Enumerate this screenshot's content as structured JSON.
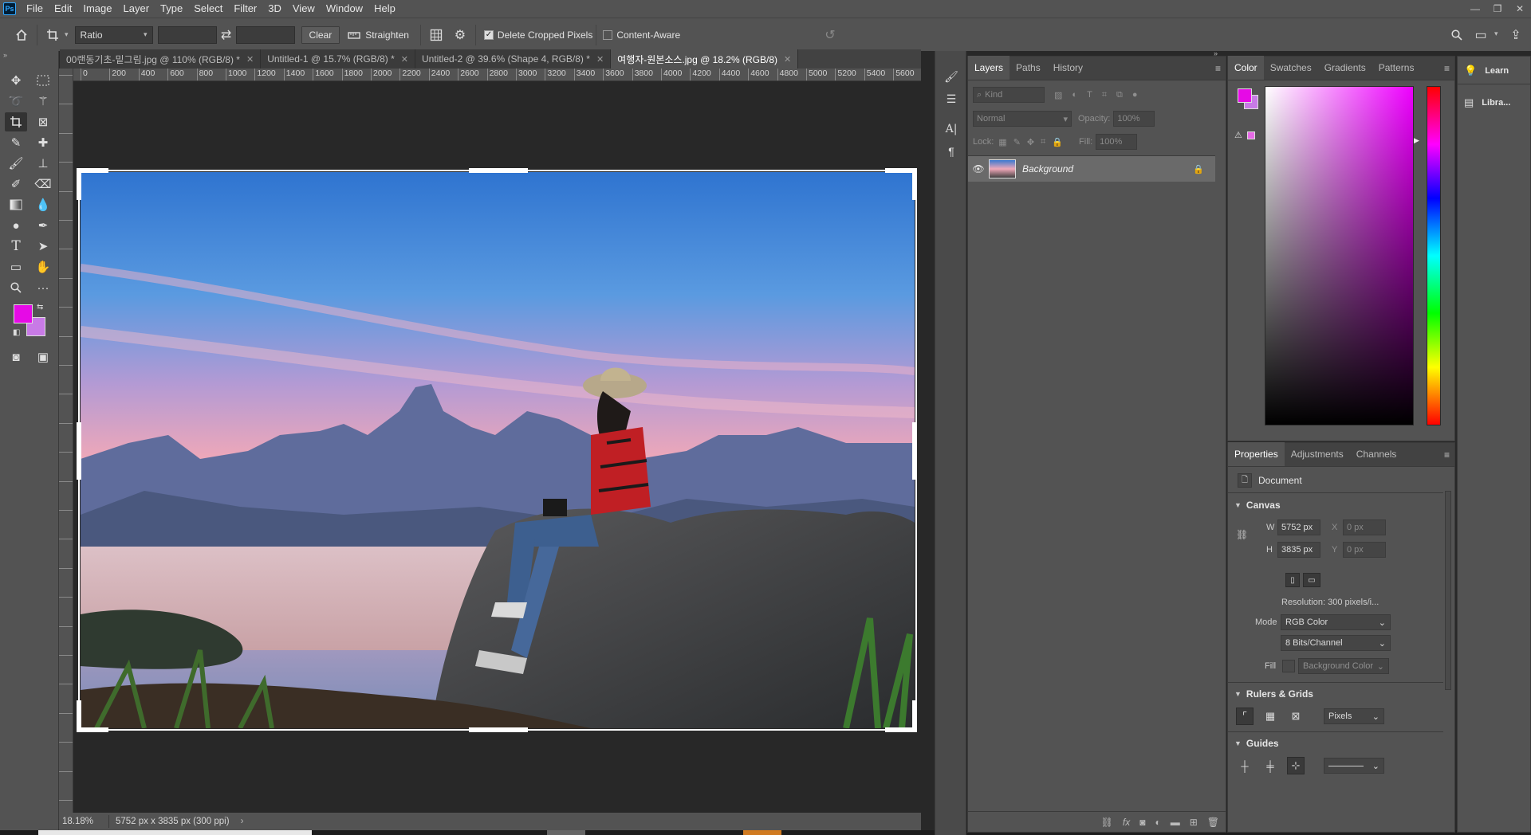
{
  "app": {
    "logo": "Ps"
  },
  "menu": [
    "File",
    "Edit",
    "Image",
    "Layer",
    "Type",
    "Select",
    "Filter",
    "3D",
    "View",
    "Window",
    "Help"
  ],
  "window_controls": {
    "minimize": "—",
    "restore": "❐",
    "close": "✕"
  },
  "options": {
    "ratio_label": "Ratio",
    "clear_label": "Clear",
    "straighten_label": "Straighten",
    "delete_cropped_label": "Delete Cropped Pixels",
    "delete_cropped_checked": true,
    "content_aware_label": "Content-Aware",
    "content_aware_checked": false
  },
  "doc_tabs": [
    {
      "label": "00랜동기초-밑그림.jpg @ 110% (RGB/8) *",
      "active": false
    },
    {
      "label": "Untitled-1 @ 15.7% (RGB/8) *",
      "active": false
    },
    {
      "label": "Untitled-2 @ 39.6% (Shape 4, RGB/8) *",
      "active": false
    },
    {
      "label": "여행자-원본소스.jpg @ 18.2% (RGB/8)",
      "active": true
    }
  ],
  "ruler_h": [
    "0",
    "200",
    "400",
    "600",
    "800",
    "1000",
    "1200",
    "1400",
    "1600",
    "1800",
    "2000",
    "2200",
    "2400",
    "2600",
    "2800",
    "3000",
    "3200",
    "3400",
    "3600",
    "3800",
    "4000",
    "4200",
    "4400",
    "4600",
    "4800",
    "5000",
    "5200",
    "5400",
    "5600"
  ],
  "status": {
    "zoom": "18.18%",
    "info": "5752 px x 3835 px (300 ppi)",
    "arrow": "›"
  },
  "layers_panel": {
    "tabs": [
      "Layers",
      "Paths",
      "History"
    ],
    "kind_placeholder": "Kind",
    "blend_mode": "Normal",
    "opacity_label": "Opacity:",
    "opacity_value": "100%",
    "lock_label": "Lock:",
    "fill_label": "Fill:",
    "fill_value": "100%",
    "layer_name": "Background"
  },
  "color_panel": {
    "tabs": [
      "Color",
      "Swatches",
      "Gradients",
      "Patterns"
    ],
    "foreground": "#e60ae6",
    "background": "#c87ae6"
  },
  "learn_panel": {
    "learn": "Learn",
    "libraries": "Libra..."
  },
  "properties_panel": {
    "tabs": [
      "Properties",
      "Adjustments",
      "Channels"
    ],
    "doc_label": "Document",
    "canvas_header": "Canvas",
    "w_label": "W",
    "w_value": "5752 px",
    "h_label": "H",
    "h_value": "3835 px",
    "x_label": "X",
    "x_value": "0 px",
    "y_label": "Y",
    "y_value": "0 px",
    "resolution": "Resolution: 300 pixels/i...",
    "mode_label": "Mode",
    "mode_value": "RGB Color",
    "bits_value": "8 Bits/Channel",
    "fill_label": "Fill",
    "fill_value": "Background Color",
    "rulers_header": "Rulers & Grids",
    "units_value": "Pixels",
    "guides_header": "Guides"
  }
}
